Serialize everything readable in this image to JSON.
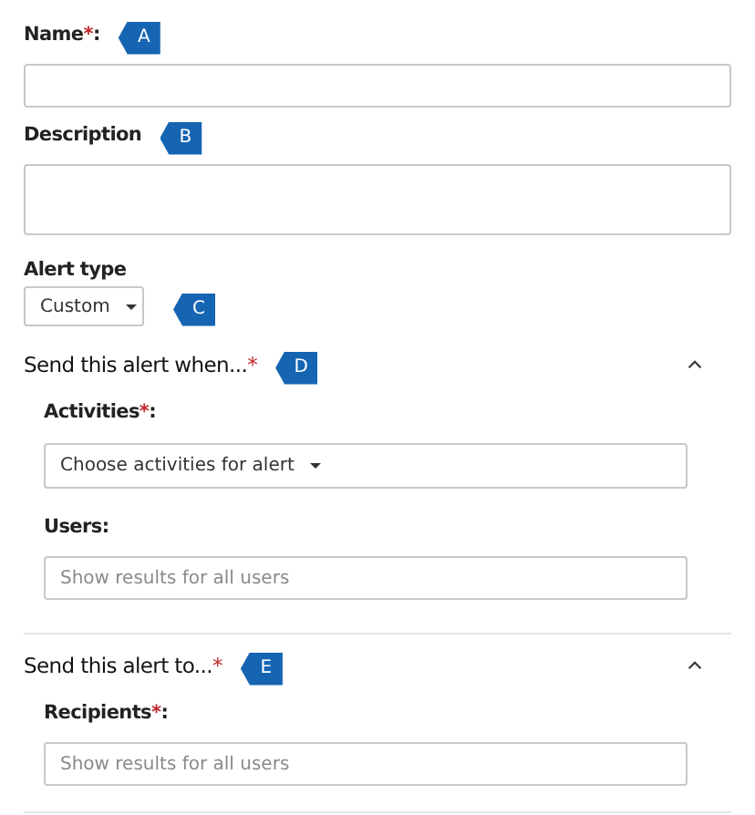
{
  "fields": [
    {
      "kind": "text",
      "label": "Name",
      "required_mark": "*",
      "suffix": ":",
      "callout": "A"
    },
    {
      "kind": "textarea",
      "label": "Description",
      "callout": "B"
    },
    {
      "kind": "dropdown",
      "label": "Alert type",
      "value": "Custom",
      "callout": "C"
    }
  ],
  "sections": [
    {
      "title": "Send this alert when...",
      "required_mark": "*",
      "callout": "D",
      "expanded": true,
      "fields": [
        {
          "kind": "combo",
          "label": "Activities",
          "required_mark": "*",
          "suffix": ":",
          "value": "Choose activities for alert"
        },
        {
          "kind": "text",
          "label": "Users",
          "suffix": ":",
          "placeholder": "Show results for all users"
        }
      ]
    },
    {
      "title": "Send this alert to...",
      "required_mark": "*",
      "callout": "E",
      "expanded": true,
      "fields": [
        {
          "kind": "text",
          "label": "Recipients",
          "required_mark": "*",
          "suffix": ":",
          "placeholder": "Show results for all users"
        }
      ]
    }
  ]
}
